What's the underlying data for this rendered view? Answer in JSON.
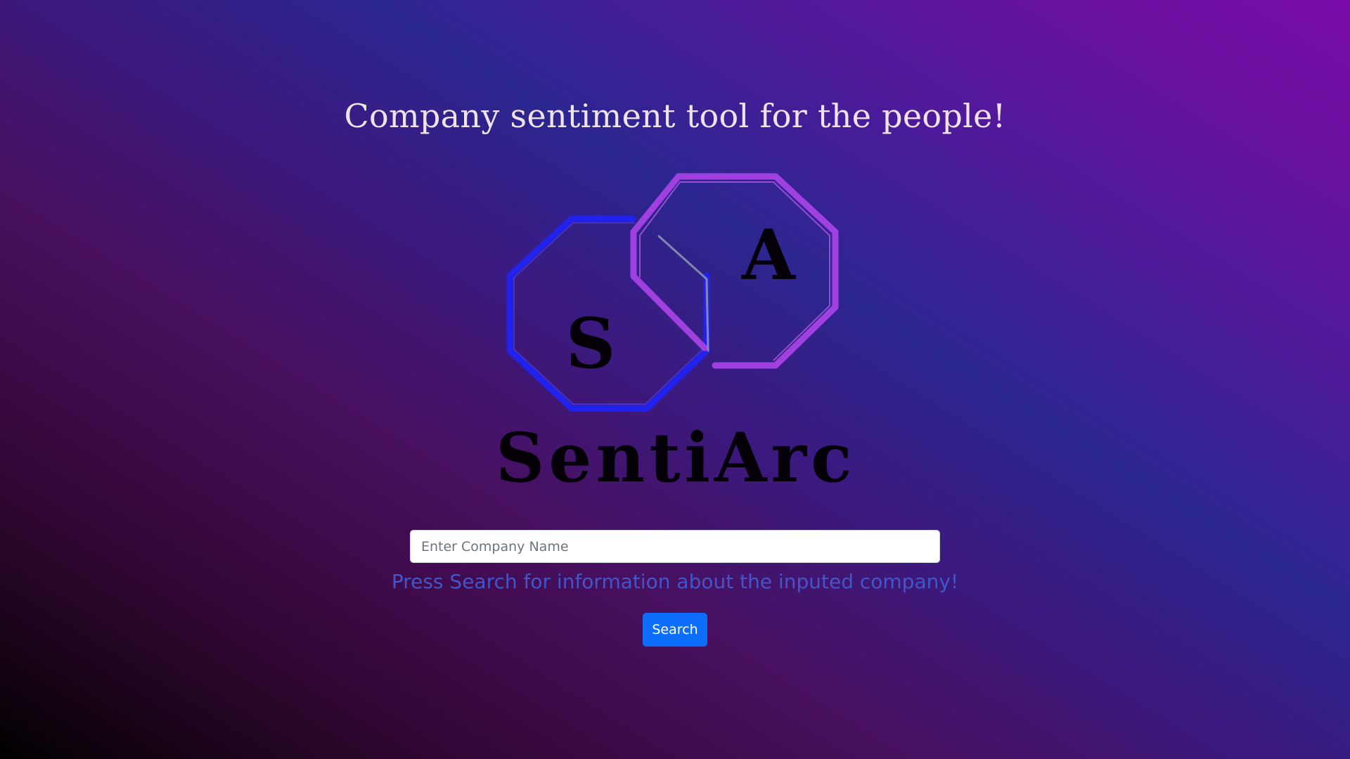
{
  "header": {
    "headline": "Company sentiment tool for the people!"
  },
  "logo": {
    "left_letter": "S",
    "right_letter": "A",
    "wordmark": "SentiArc",
    "colors": {
      "left_octagon": "#2222ee",
      "right_octagon": "#a040e0",
      "letters": "#050008"
    }
  },
  "search": {
    "placeholder": "Enter Company Name",
    "value": "",
    "hint": "Press Search for information about the inputed company!",
    "button_label": "Search"
  },
  "colors": {
    "hint_text": "#4355c8",
    "button_bg": "#0d6efd"
  }
}
